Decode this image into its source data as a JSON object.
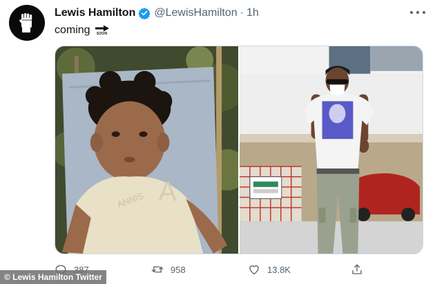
{
  "author": {
    "display_name": "Lewis Hamilton",
    "handle": "@LewisHamilton",
    "separator": "·",
    "timestamp": "1h",
    "verified_color": "#1d9bf0",
    "avatar_icon": "raised-fist-icon"
  },
  "tweet": {
    "text": "coming",
    "emoji_text": "SOON",
    "emoji_icon": "soon-arrow-icon"
  },
  "media": {
    "photos": [
      {
        "subject": "toddler in t-shirt sitting in deck chair",
        "shirt_print": "ANNIS"
      },
      {
        "subject": "man in white t-shirt and face mask walking in paddock"
      }
    ]
  },
  "actions": {
    "reply_count": "387",
    "retweet_count": "958",
    "like_count": "13.8K"
  },
  "credit": {
    "text": "© Lewis Hamilton Twitter"
  },
  "colors": {
    "text_primary": "#0f1419",
    "text_secondary": "#536471",
    "border": "#cfd9de"
  }
}
